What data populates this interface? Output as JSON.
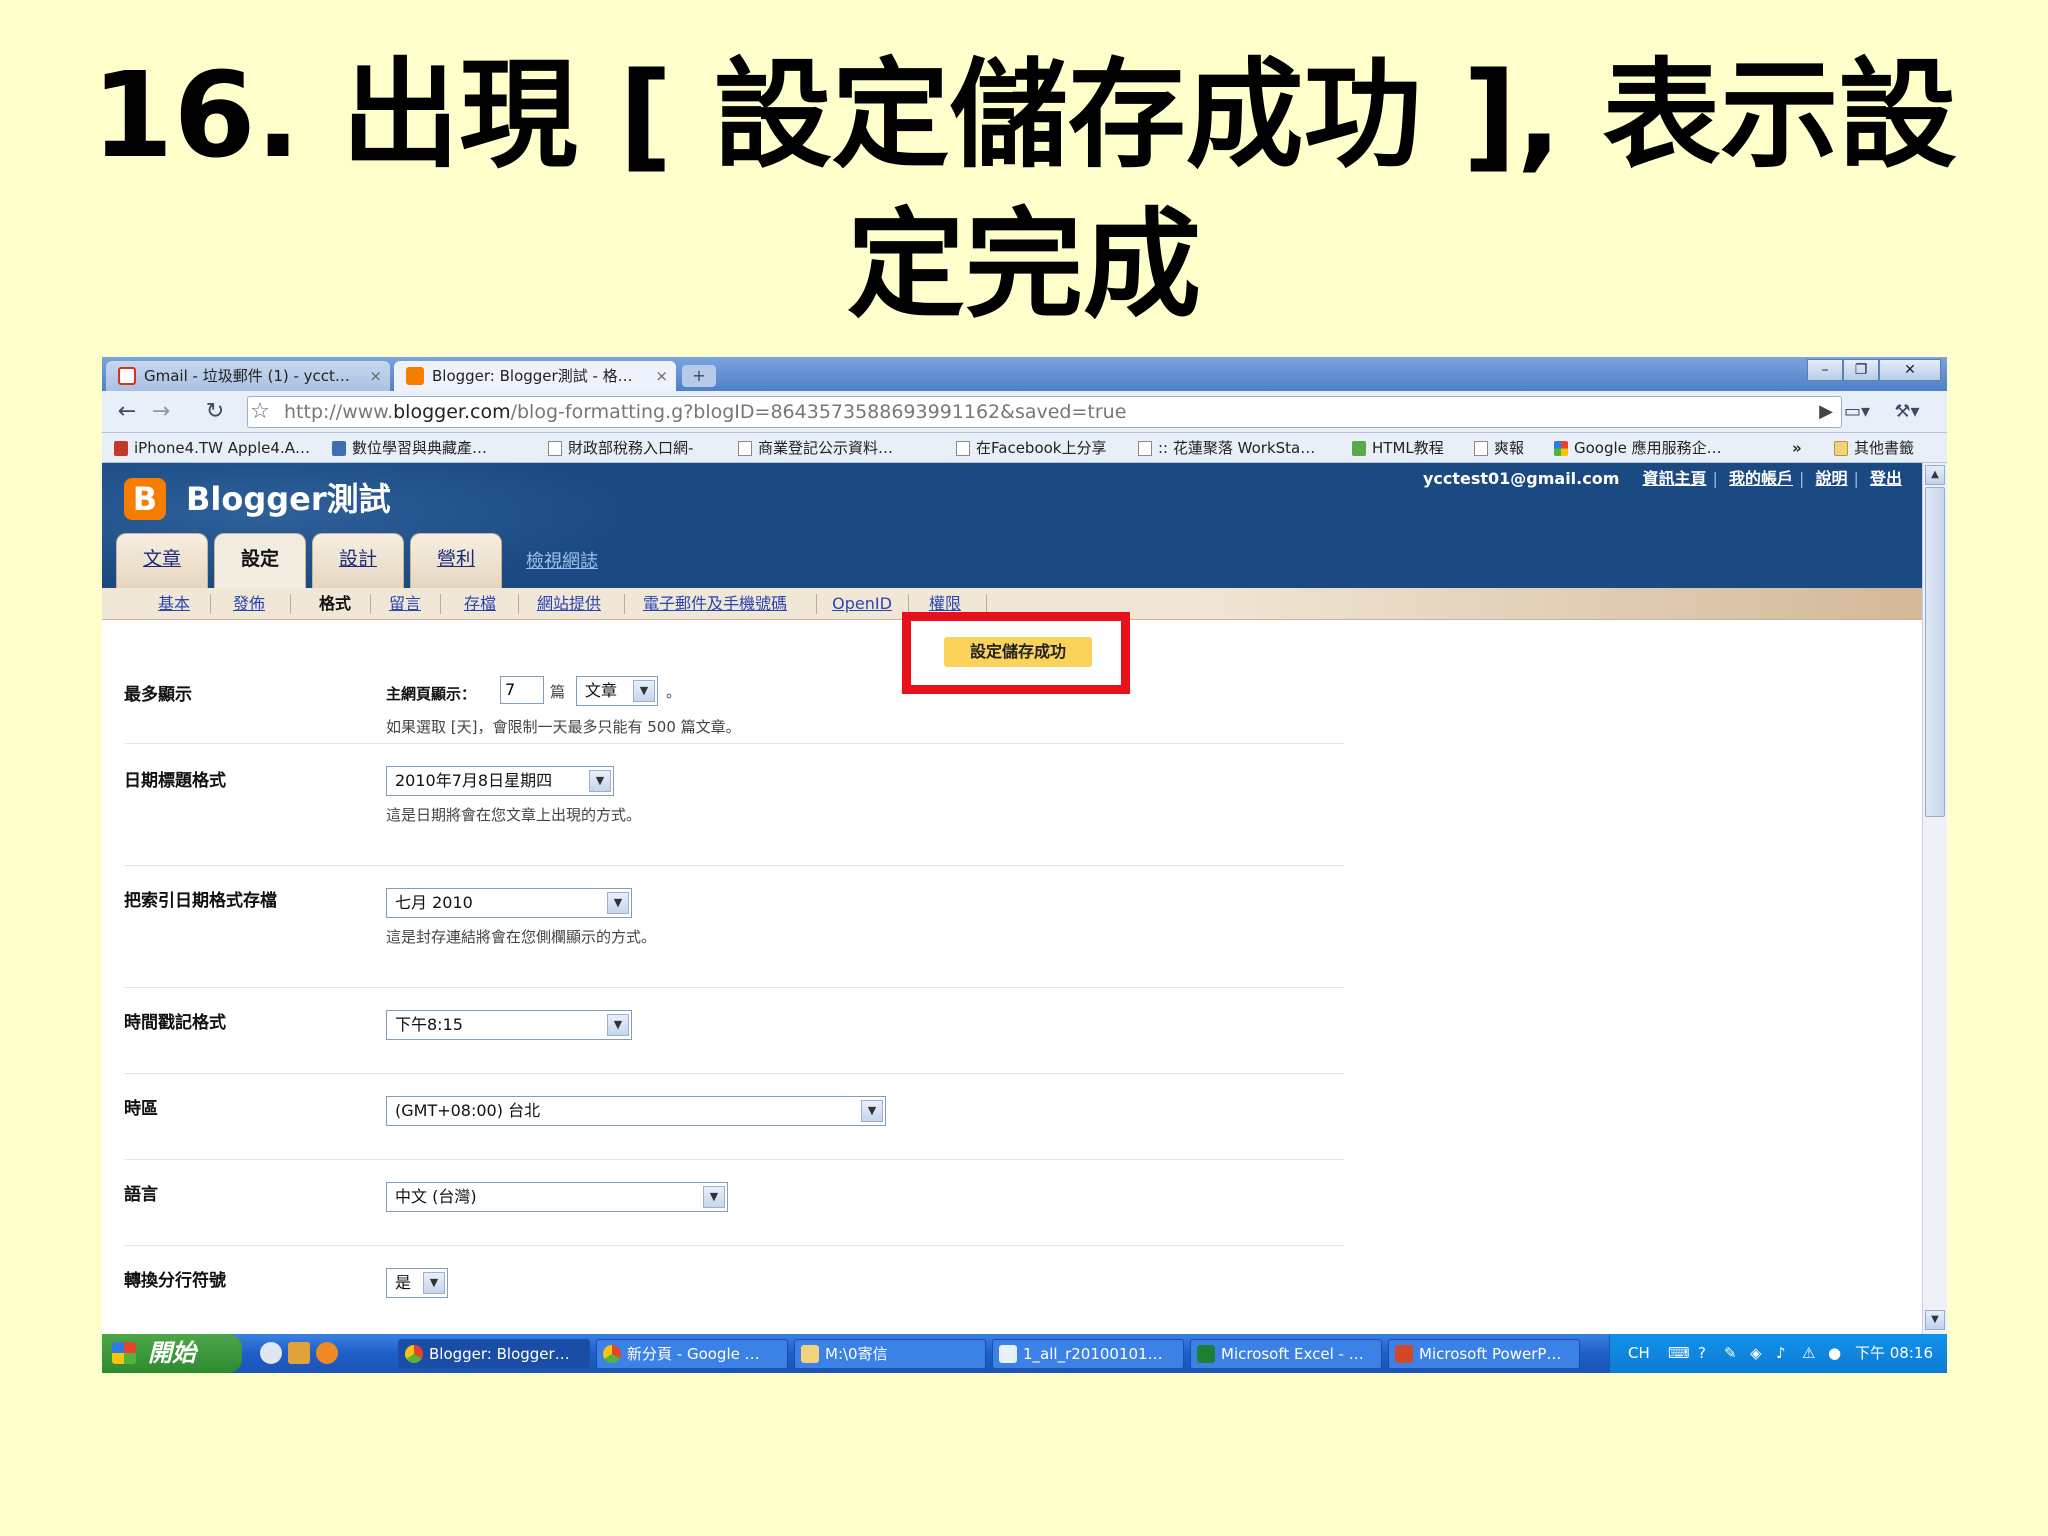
{
  "slide": {
    "title_line1": "16. 出現 [ 設定儲存成功 ], 表示設",
    "title_line2": "定完成"
  },
  "browser": {
    "tabs": [
      {
        "label": "Gmail - 垃圾郵件 (1) - ycct…",
        "icon": "gmail-icon",
        "color": "#d93025"
      },
      {
        "label": "Blogger: Blogger測試 - 格…",
        "icon": "blogger-icon",
        "color": "#f57d00"
      }
    ],
    "new_tab": "+",
    "window_controls": [
      "–",
      "❐",
      "✕"
    ],
    "url_host_prefix": "http://www.",
    "url_host": "blogger.com",
    "url_rest": "/blog-formatting.g?blogID=8643573588693991162&saved=true",
    "bookmarks": [
      "iPhone4.TW Apple4.A…",
      "數位學習與典藏產…",
      "財政部稅務入口網-",
      "商業登記公示資料…",
      "在Facebook上分享",
      ":: 花蓮聚落 WorkSta…",
      "HTML教程",
      "爽報",
      "Google 應用服務企…"
    ],
    "bookmarks_more": "»",
    "other_bookmarks": "其他書籤"
  },
  "blogger": {
    "blog_title": "Blogger測試",
    "email": "ycctest01@gmail.com",
    "top_links": [
      "資訊主頁",
      "我的帳戶",
      "說明",
      "登出"
    ],
    "main_tabs": [
      "文章",
      "設定",
      "設計",
      "營利"
    ],
    "view_blog": "檢視網誌",
    "sub_tabs": [
      "基本",
      "發佈",
      "格式",
      "留言",
      "存檔",
      "網站提供",
      "電子郵件及手機號碼",
      "OpenID",
      "權限"
    ],
    "success_message": "設定儲存成功"
  },
  "settings": {
    "max_show_label": "最多顯示",
    "max_show_prefix": "主網頁顯示：",
    "max_show_value": "7",
    "max_show_unit": "篇",
    "max_show_select": "文章",
    "max_show_period": "。",
    "max_show_hint": "如果選取 [天]，會限制一天最多只能有 500 篇文章。",
    "date_header_label": "日期標題格式",
    "date_header_value": "2010年7月8日星期四",
    "date_header_hint": "這是日期將會在您文章上出現的方式。",
    "archive_label": "把索引日期格式存檔",
    "archive_value": "七月 2010",
    "archive_hint": "這是封存連結將會在您側欄顯示的方式。",
    "timestamp_label": "時間戳記格式",
    "timestamp_value": "下午8:15",
    "timezone_label": "時區",
    "timezone_value": "(GMT+08:00) 台北",
    "language_label": "語言",
    "language_value": "中文 (台灣)",
    "convert_label": "轉換分行符號",
    "convert_value": "是"
  },
  "taskbar": {
    "start": "開始",
    "tasks": [
      "Blogger: Blogger…",
      "新分頁 - Google …",
      "M:\\0寄信",
      "1_all_r20100101…",
      "Microsoft Excel - …",
      "Microsoft PowerP…"
    ],
    "lang": "CH",
    "clock": "下午 08:16"
  }
}
